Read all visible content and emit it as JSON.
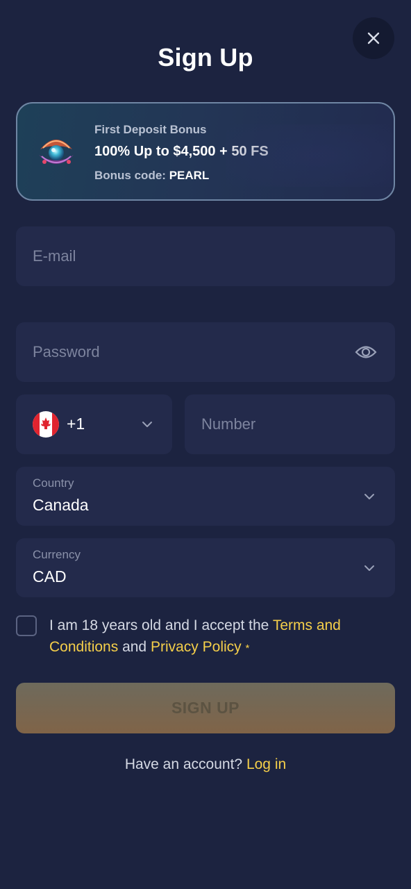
{
  "header": {
    "title": "Sign Up",
    "close_icon": "close-icon"
  },
  "bonus": {
    "kicker": "First Deposit Bonus",
    "offer": "100% Up to $4,500 + 50 FS",
    "code_label": "Bonus code:",
    "code_value": "PEARL",
    "icon": "pearl-shell-icon"
  },
  "form": {
    "email_placeholder": "E-mail",
    "password_placeholder": "Password",
    "password_toggle_icon": "eye-icon",
    "phone_country_flag": "canada-flag-icon",
    "phone_dial_code": "+1",
    "number_placeholder": "Number",
    "country_label": "Country",
    "country_value": "Canada",
    "currency_label": "Currency",
    "currency_value": "CAD"
  },
  "terms": {
    "text_before": "I am 18 years old and I accept the ",
    "terms_link": "Terms and Conditions",
    "text_middle": " and ",
    "privacy_link": "Privacy Policy",
    "required_mark": "*",
    "checked": false
  },
  "actions": {
    "signup_label": "SIGN UP",
    "have_account_text": "Have an account?",
    "login_link": "Log in"
  },
  "colors": {
    "background": "#1c2340",
    "field": "#232a4b",
    "accent_link": "#f5cf4a",
    "bonus_border": "#6f86a4"
  }
}
